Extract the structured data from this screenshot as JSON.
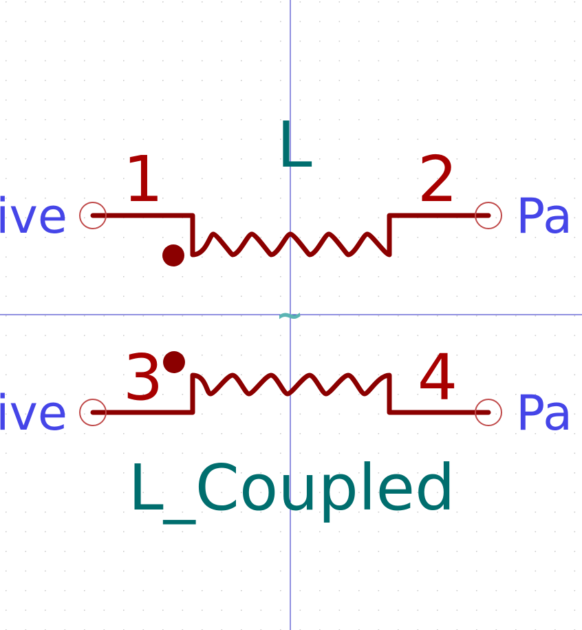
{
  "symbol": {
    "reference": "L",
    "value": "L_Coupled",
    "coupling_mark": "~"
  },
  "pins": [
    {
      "number": "1",
      "type_label": "ive"
    },
    {
      "number": "2",
      "type_label": "Pa"
    },
    {
      "number": "3",
      "type_label": "ive"
    },
    {
      "number": "4",
      "type_label": "Pa"
    }
  ],
  "colors": {
    "background": "#ffffff",
    "grid_dot": "#c8c8c8",
    "axis": "#2020c0",
    "body": "#8b0000",
    "pin_number": "#a80000",
    "pin_type": "#4545e8",
    "field_text": "#006e6e",
    "coupling": "#5ab4b4",
    "pin_end": "#c04a4a"
  }
}
